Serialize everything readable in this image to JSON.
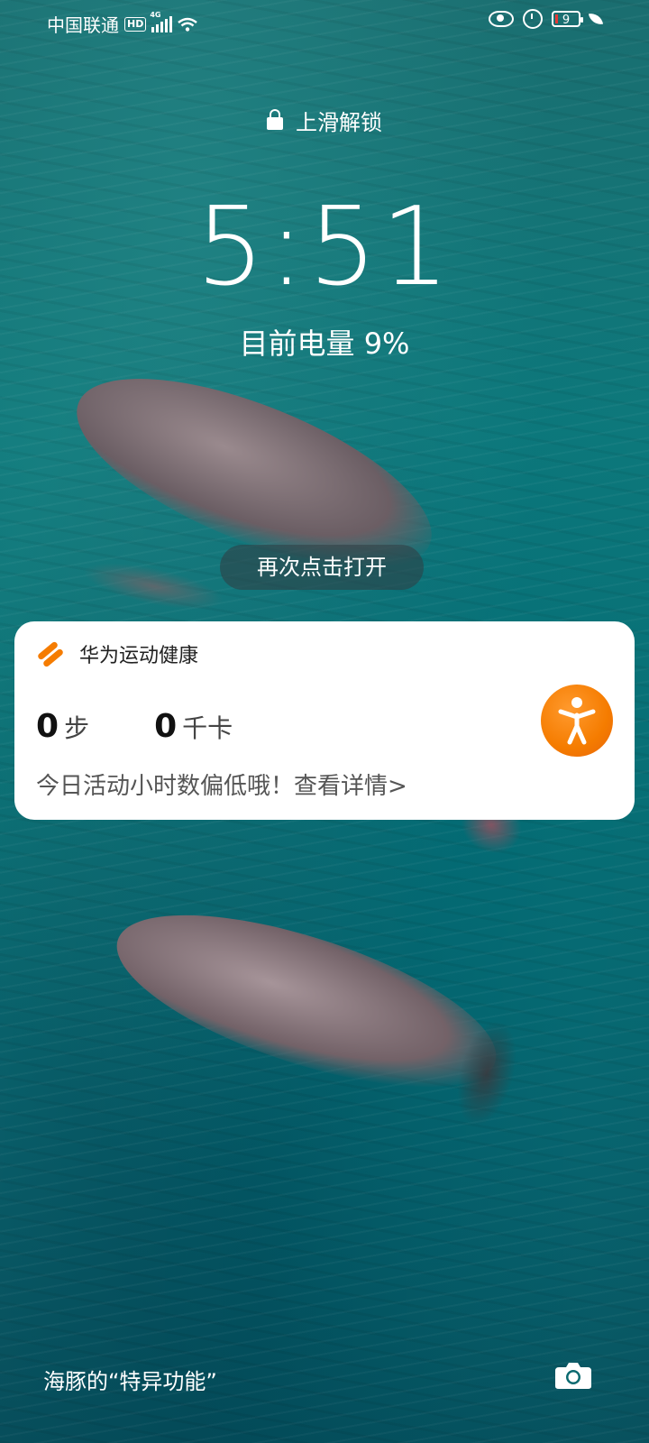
{
  "status_bar": {
    "carrier": "中国联通",
    "hd_badge": "HD",
    "network": "4G",
    "battery_level": "9",
    "battery_percent": 9,
    "icons": [
      "hd-icon",
      "signal-icon",
      "wifi-icon",
      "eye-comfort-icon",
      "alarm-icon",
      "battery-icon",
      "power-saving-leaf-icon"
    ]
  },
  "lock_screen": {
    "unlock_hint": "上滑解锁",
    "time": "5:51",
    "battery_status": "目前电量 9%",
    "tap_hint": "再次点击打开"
  },
  "notification": {
    "app_name": "华为运动健康",
    "steps_value": "0",
    "steps_unit": "步",
    "calories_value": "0",
    "calories_unit": "千卡",
    "message": "今日活动小时数偏低哦！查看详情>",
    "accent_color": "#f57c00",
    "action_icon": "person-activity-icon"
  },
  "bottom": {
    "wallpaper_caption": "海豚的“特异功能”",
    "camera_icon": "camera-icon"
  }
}
